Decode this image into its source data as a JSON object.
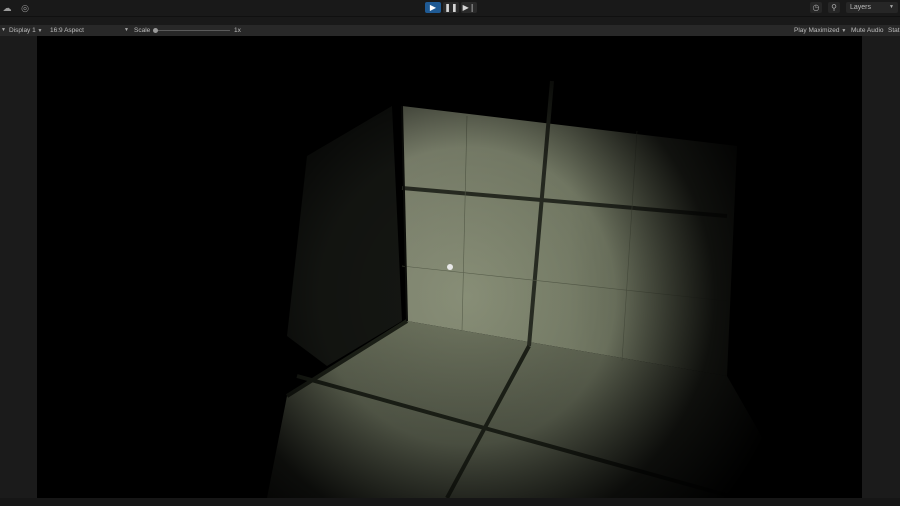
{
  "toolbar": {
    "left_icons": [
      "cloud-icon",
      "account-icon"
    ],
    "play_controls": [
      "play-icon",
      "pause-icon",
      "step-icon"
    ],
    "history_icon": "history-icon",
    "search_icon": "search-icon",
    "layers_label": "Layers"
  },
  "game_view": {
    "display": "Display 1",
    "aspect": "16:9 Aspect",
    "scale_label": "Scale",
    "scale_value": "1x",
    "play_mode": "Play Maximized",
    "mute_audio": "Mute Audio",
    "stats": "Stat"
  },
  "colors": {
    "play_active": "#1f5a94",
    "tile_lit": "#7f8570",
    "grout": "#1d2118"
  }
}
